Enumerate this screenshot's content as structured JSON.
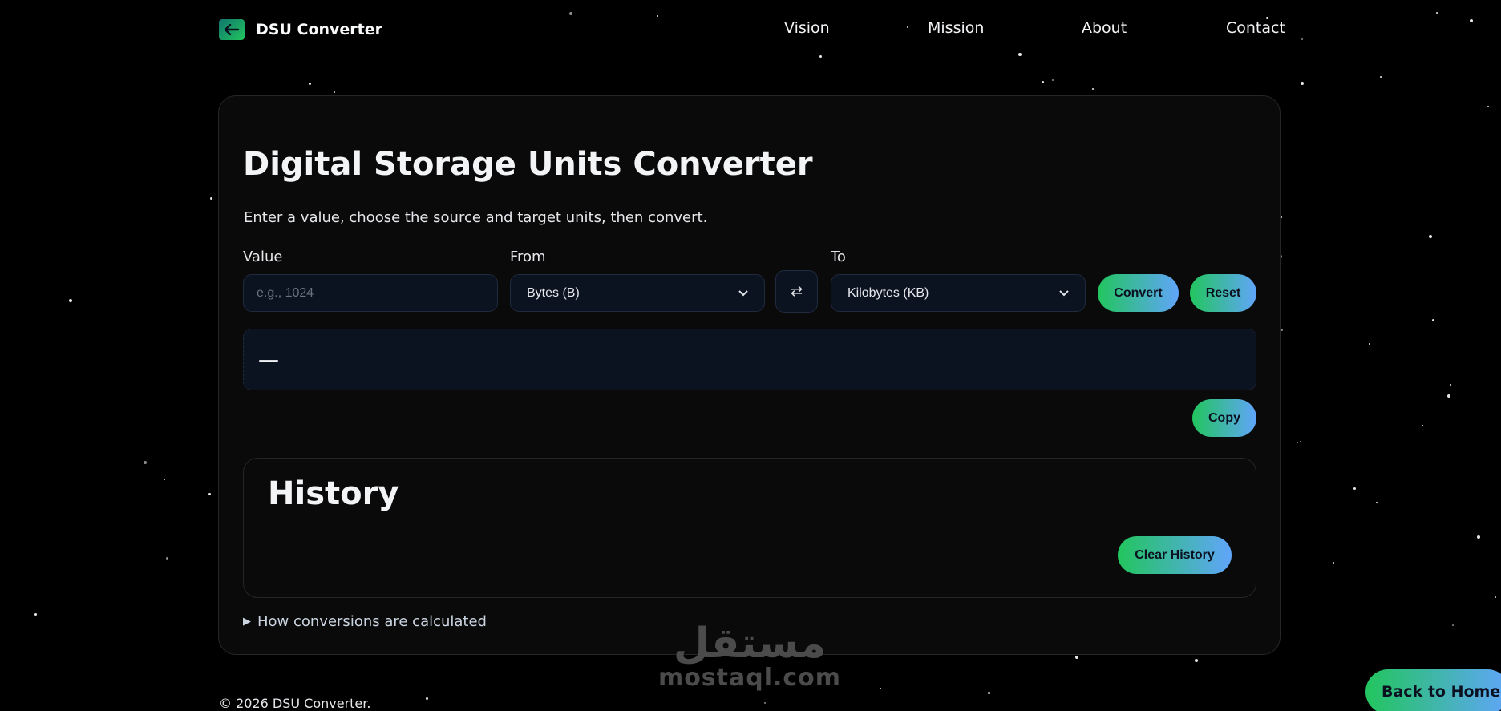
{
  "brand": {
    "name": "DSU Converter",
    "icon": "arrow-left-box-icon"
  },
  "nav": {
    "items": [
      "Vision",
      "Mission",
      "About",
      "Contact"
    ]
  },
  "converter": {
    "title": "Digital Storage Units Converter",
    "subtitle": "Enter a value, choose the source and target units, then convert.",
    "value_label": "Value",
    "value_placeholder": "e.g., 1024",
    "from_label": "From",
    "from_selected": "Bytes (B)",
    "to_label": "To",
    "to_selected": "Kilobytes (KB)",
    "swap_glyph": "⇄",
    "convert_label": "Convert",
    "reset_label": "Reset",
    "result_text": "—",
    "copy_label": "Copy"
  },
  "history": {
    "title": "History",
    "clear_label": "Clear History"
  },
  "details": {
    "summary": "How conversions are calculated"
  },
  "footer": {
    "text": "© 2026 DSU Converter."
  },
  "back_home_label": "Back to Home",
  "watermark": {
    "arabic": "مستقل",
    "latin": "mostaql.com"
  },
  "colors": {
    "background": "#000000",
    "card": "#0a0a0a",
    "field": "#0b1220",
    "accent_start": "#22c55e",
    "accent_end": "#60a5fa"
  }
}
